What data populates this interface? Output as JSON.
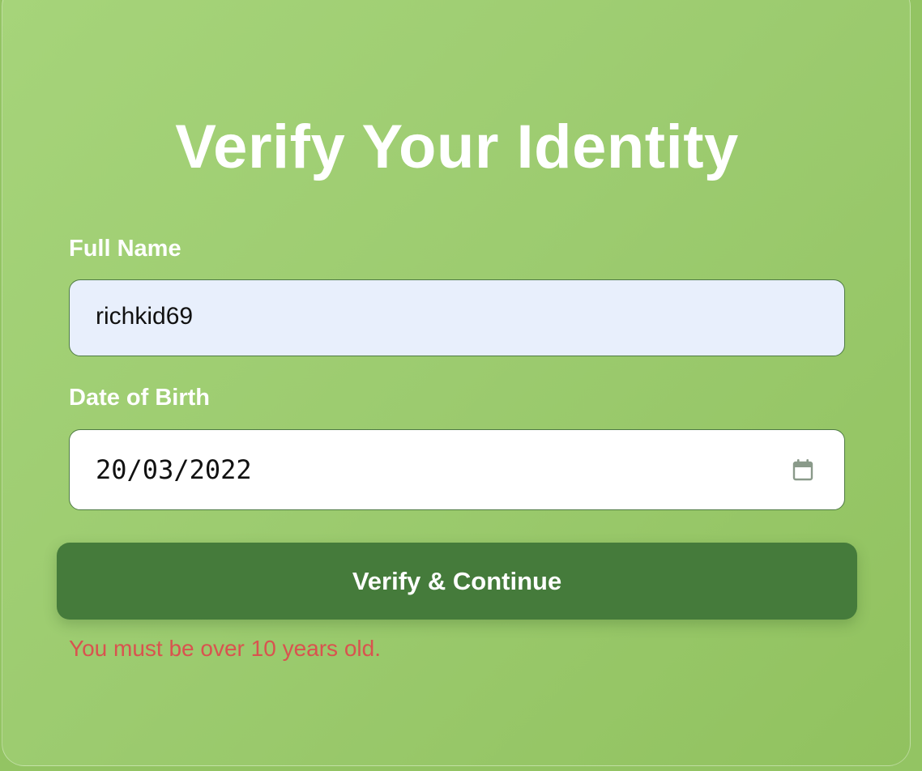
{
  "title": "Verify Your Identity",
  "form": {
    "full_name": {
      "label": "Full Name",
      "value": "richkid69"
    },
    "dob": {
      "label": "Date of Birth",
      "value": "20/03/2022",
      "icon": "calendar-icon"
    },
    "submit_label": "Verify & Continue",
    "error_message": "You must be over 10 years old."
  },
  "colors": {
    "background": "#9ccb6f",
    "button": "#457b3b",
    "error": "#d9534f",
    "autofill_field": "#e8effc"
  }
}
